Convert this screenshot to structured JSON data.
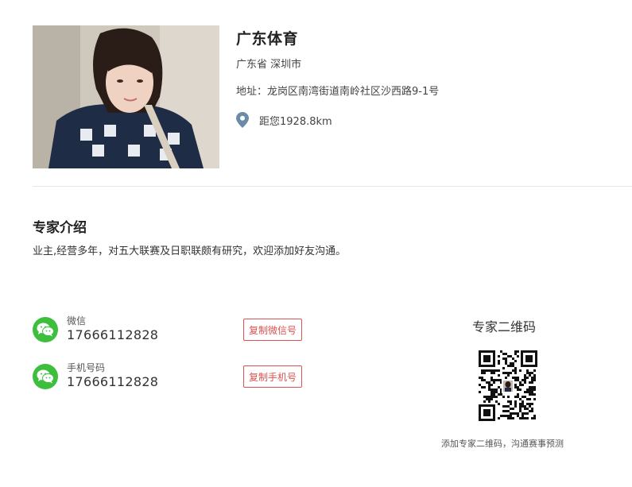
{
  "profile": {
    "name": "广东体育",
    "region": "广东省 深圳市",
    "address": "地址：龙岗区南湾街道南岭社区沙西路9-1号",
    "distance": "距您1928.8km",
    "avatar_icon": "profile-photo"
  },
  "intro": {
    "heading": "专家介绍",
    "text": "业主,经营多年，对五大联赛及日职联颇有研究，欢迎添加好友沟通。"
  },
  "contacts": {
    "wechat": {
      "label": "微信",
      "value": "17666112828",
      "copy_label": "复制微信号",
      "icon": "wechat-icon"
    },
    "phone": {
      "label": "手机号码",
      "value": "17666112828",
      "copy_label": "复制手机号",
      "icon": "wechat-icon"
    }
  },
  "qr": {
    "title": "专家二维码",
    "caption": "添加专家二维码，沟通赛事预测"
  },
  "colors": {
    "accent_red": "#d9534f",
    "wechat_green": "#3dbf3d",
    "pin_blue": "#6b8ba8"
  }
}
